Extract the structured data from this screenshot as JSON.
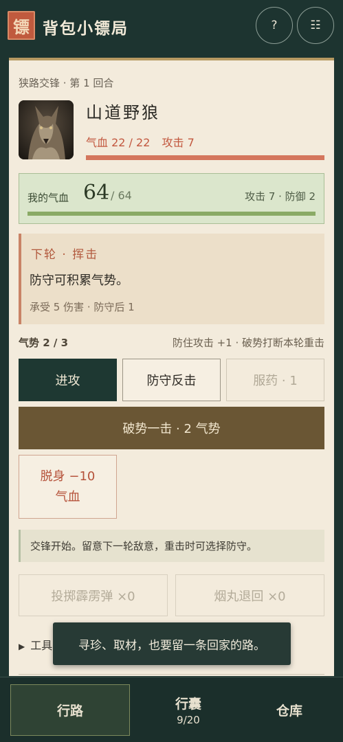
{
  "app": {
    "logo_char": "镖",
    "title": "背包小镖局",
    "help_label": "?",
    "menu_label": "☷"
  },
  "encounter": {
    "header": "狭路交锋 · 第 1 回合",
    "enemy_name": "山道野狼",
    "enemy_hp_label": "气血",
    "enemy_hp": "22 / 22",
    "enemy_attack": "攻击 7",
    "enemy_hp_fraction": 1.0
  },
  "player": {
    "hp_label": "我的气血",
    "hp": "64",
    "hp_max": "/ 64",
    "stats": "攻击 7 · 防御 2",
    "hp_fraction": 1.0
  },
  "intent": {
    "title": "下轮 · 挥击",
    "text": "防守可积累气势。",
    "meta": "承受 5 伤害 · 防守后 1"
  },
  "momentum": {
    "label": "气势 2 / 3",
    "tip": "防住攻击 +1 · 破势打断本轮重击"
  },
  "actions": {
    "attack": "进攻",
    "defend": "防守反击",
    "potion": "服药 · 1",
    "break": "破势一击 · 2 气势",
    "flee_line1": "脱身 −10",
    "flee_line2": "气血"
  },
  "log": "交锋开始。留意下一轮敌意，重击时可选择防守。",
  "tools": {
    "bomb": "投掷霹雳弹 ×0",
    "smoke": "烟丸退回 ×0",
    "toggle": "工具与道具"
  },
  "toast": "寻珍、取材，也要留一条回家的路。",
  "nav": {
    "road": "行路",
    "pack": "行囊",
    "pack_count": "9/20",
    "store": "仓库"
  },
  "colors": {
    "bg": "#1d3430",
    "panel": "#f3ebdc",
    "enemy_red": "#c2573e",
    "player_green": "#8aaa66",
    "accent_brown": "#6a5634"
  }
}
